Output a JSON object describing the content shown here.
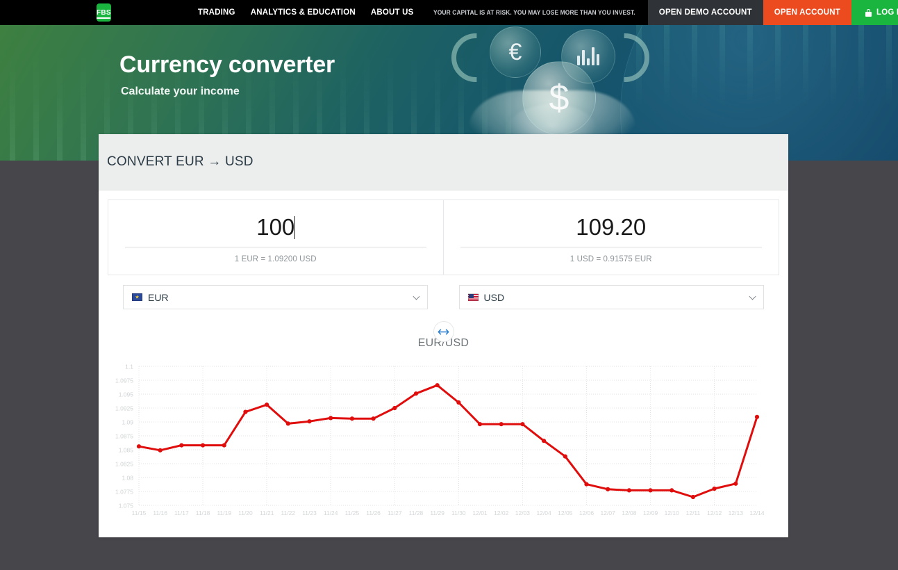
{
  "nav": {
    "logo": "FBS",
    "links": [
      {
        "label": "TRADING"
      },
      {
        "label": "ANALYTICS & EDUCATION"
      },
      {
        "label": "ABOUT US"
      }
    ],
    "risk_warning": "YOUR CAPITAL IS AT RISK. YOU MAY LOSE MORE THAN YOU INVEST.",
    "demo_button": "OPEN DEMO ACCOUNT",
    "open_button": "OPEN ACCOUNT",
    "login_button": "LOG IN"
  },
  "hero": {
    "title": "Currency converter",
    "subtitle": "Calculate your income",
    "symbol_eur": "€",
    "symbol_usd": "$"
  },
  "converter": {
    "header": "CONVERT EUR → USD",
    "from": {
      "amount": "100",
      "rate_note": "1 EUR = 1.09200 USD",
      "currency_code": "EUR",
      "flag": "eu-flag-icon"
    },
    "to": {
      "amount": "109.20",
      "rate_note": "1 USD = 0.91575 EUR",
      "currency_code": "USD",
      "flag": "us-flag-icon"
    },
    "swap_icon": "swap-horizontal-icon"
  },
  "chart_data": {
    "type": "line",
    "title": "EUR/USD",
    "xlabel": "",
    "ylabel": "",
    "ylim": [
      1.075,
      1.1
    ],
    "ytick_step": 0.0025,
    "grid": true,
    "legend": false,
    "line_color": "#e00d0d",
    "marker": "circle",
    "categories": [
      "11/15",
      "11/16",
      "11/17",
      "11/18",
      "11/19",
      "11/20",
      "11/21",
      "11/22",
      "11/23",
      "11/24",
      "11/25",
      "11/26",
      "11/27",
      "11/28",
      "11/29",
      "11/30",
      "12/01",
      "12/02",
      "12/03",
      "12/04",
      "12/05",
      "12/06",
      "12/07",
      "12/08",
      "12/09",
      "12/10",
      "12/11",
      "12/12",
      "12/13",
      "12/14"
    ],
    "yticks": [
      "1.1",
      "1.0975",
      "1.095",
      "1.0925",
      "1.09",
      "1.0875",
      "1.085",
      "1.0825",
      "1.08",
      "1.0775",
      "1.075"
    ],
    "values": [
      1.0856,
      1.0849,
      1.0858,
      1.0858,
      1.0858,
      1.0918,
      1.0931,
      1.0897,
      1.0901,
      1.0907,
      1.0906,
      1.0906,
      1.0925,
      1.0951,
      1.0966,
      1.0935,
      1.0896,
      1.0896,
      1.0896,
      1.0866,
      1.0838,
      1.0788,
      1.0779,
      1.0777,
      1.0777,
      1.0777,
      1.0765,
      1.078,
      1.0789,
      1.0909
    ]
  }
}
